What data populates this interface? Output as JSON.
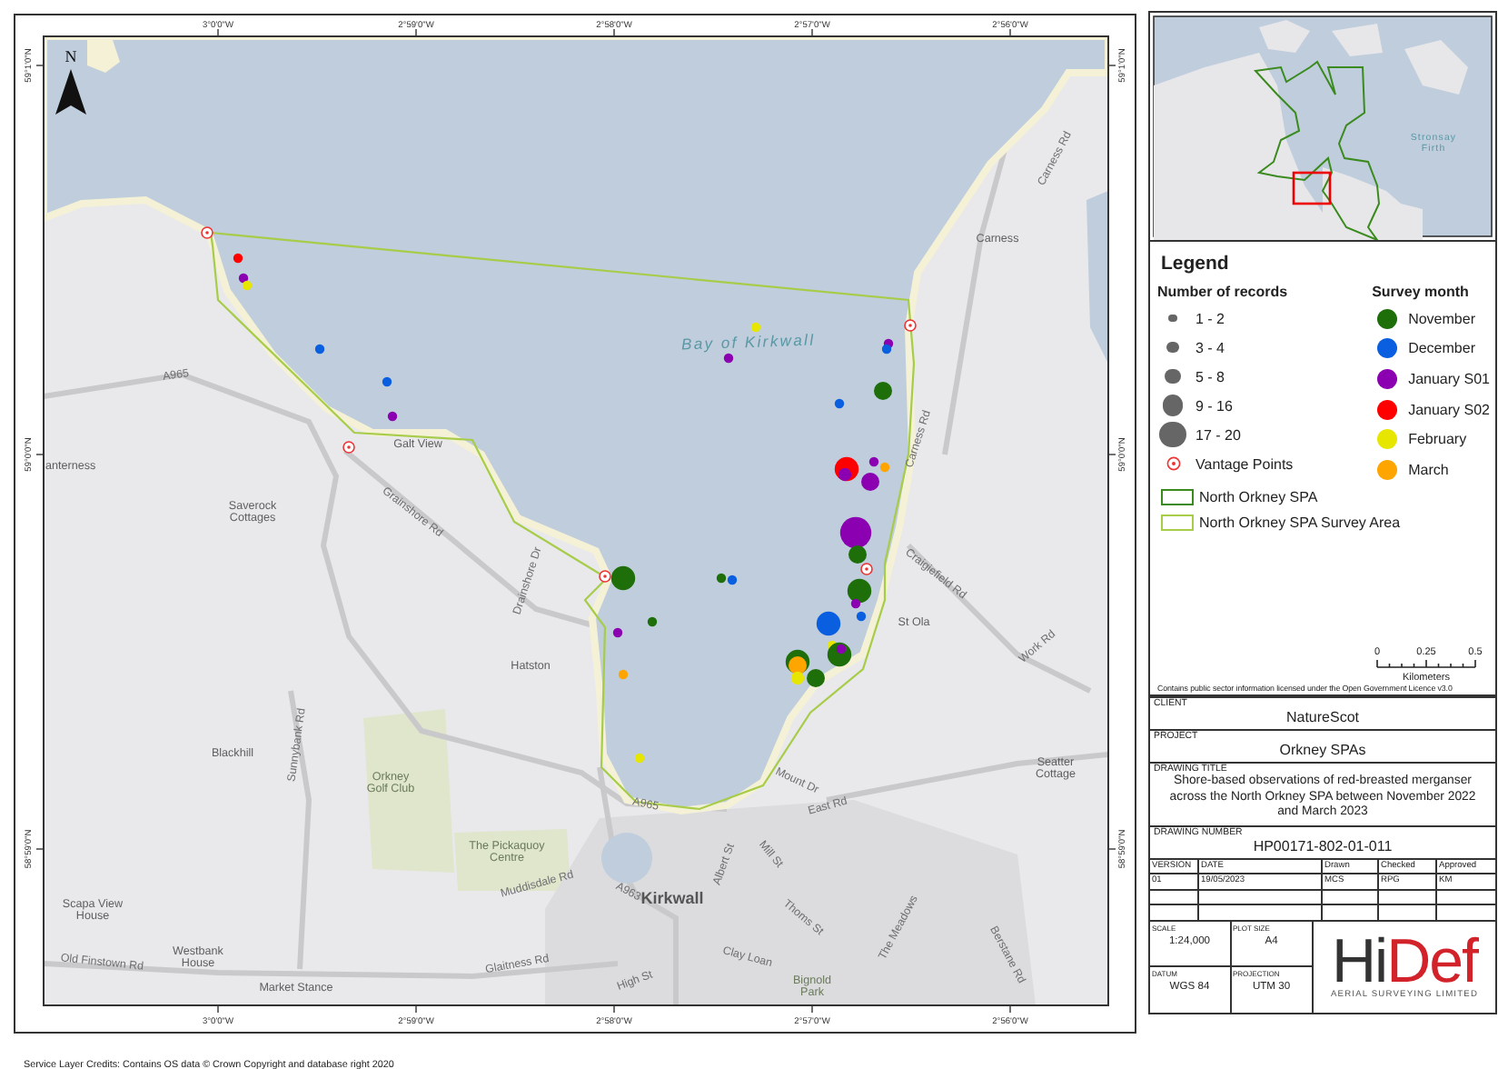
{
  "map": {
    "graticule": {
      "top": [
        "3°0'0\"W",
        "2°59'0\"W",
        "2°58'0\"W",
        "2°57'0\"W",
        "2°56'0\"W"
      ],
      "bottom": [
        "3°0'0\"W",
        "2°59'0\"W",
        "2°58'0\"W",
        "2°57'0\"W",
        "2°56'0\"W"
      ],
      "left": [
        "59°1'0\"N",
        "59°0'0\"N",
        "58°59'0\"N"
      ],
      "right": [
        "59°1'0\"N",
        "59°0'0\"N",
        "58°59'0\"N"
      ]
    },
    "north_label": "N",
    "labels": [
      {
        "kind": "water",
        "lines": [
          "Bay of Kirkwall"
        ]
      },
      {
        "kind": "place",
        "lines": [
          "Carness"
        ]
      },
      {
        "kind": "road",
        "lines": [
          "Carness Rd"
        ]
      },
      {
        "kind": "road",
        "lines": [
          "Carness Rd"
        ]
      },
      {
        "kind": "road",
        "lines": [
          "A965"
        ]
      },
      {
        "kind": "place",
        "lines": [
          "Galt View"
        ]
      },
      {
        "kind": "place",
        "lines": [
          "anterness"
        ]
      },
      {
        "kind": "place",
        "lines": [
          "Saverock",
          "Cottages"
        ]
      },
      {
        "kind": "road",
        "lines": [
          "Grainshore Rd"
        ]
      },
      {
        "kind": "road",
        "lines": [
          "Drainshore Dr"
        ]
      },
      {
        "kind": "place",
        "lines": [
          "Hatston"
        ]
      },
      {
        "kind": "place",
        "lines": [
          "St Ola"
        ]
      },
      {
        "kind": "road",
        "lines": [
          "Craigiefield Rd"
        ]
      },
      {
        "kind": "road",
        "lines": [
          "Work Rd"
        ]
      },
      {
        "kind": "place",
        "lines": [
          "Blackhill"
        ]
      },
      {
        "kind": "road",
        "lines": [
          "Sunnybank Rd"
        ]
      },
      {
        "kind": "park",
        "lines": [
          "Orkney",
          "Golf Club"
        ]
      },
      {
        "kind": "road",
        "lines": [
          "A965"
        ]
      },
      {
        "kind": "road",
        "lines": [
          "Mount Dr"
        ]
      },
      {
        "kind": "road",
        "lines": [
          "East Rd"
        ]
      },
      {
        "kind": "place",
        "lines": [
          "Seatter",
          "Cottage"
        ]
      },
      {
        "kind": "park",
        "lines": [
          "The Pickaquoy",
          "Centre"
        ]
      },
      {
        "kind": "road",
        "lines": [
          "Muddisdale Rd"
        ]
      },
      {
        "kind": "road",
        "lines": [
          "A963"
        ]
      },
      {
        "kind": "town",
        "lines": [
          "Kirkwall"
        ]
      },
      {
        "kind": "road",
        "lines": [
          "Albert St"
        ]
      },
      {
        "kind": "road",
        "lines": [
          "Mill St"
        ]
      },
      {
        "kind": "road",
        "lines": [
          "Thoms St"
        ]
      },
      {
        "kind": "place",
        "lines": [
          "Scapa View",
          "House"
        ]
      },
      {
        "kind": "place",
        "lines": [
          "Westbank",
          "House"
        ]
      },
      {
        "kind": "road",
        "lines": [
          "Old Finstown Rd"
        ]
      },
      {
        "kind": "place",
        "lines": [
          "Market Stance"
        ]
      },
      {
        "kind": "road",
        "lines": [
          "Glaitness Rd"
        ]
      },
      {
        "kind": "road",
        "lines": [
          "High St"
        ]
      },
      {
        "kind": "road",
        "lines": [
          "Clay Loan"
        ]
      },
      {
        "kind": "park",
        "lines": [
          "Bignold",
          "Park"
        ]
      },
      {
        "kind": "road",
        "lines": [
          "The Meadows"
        ]
      },
      {
        "kind": "road",
        "lines": [
          "Berstane Rd"
        ]
      }
    ],
    "observations": [
      {
        "kind": "xs",
        "color": "#ff0000"
      },
      {
        "kind": "xs",
        "color": "#8b00b0"
      },
      {
        "kind": "xs",
        "color": "#e6e600"
      },
      {
        "kind": "xs",
        "color": "#0a5fe0"
      },
      {
        "kind": "xs",
        "color": "#0a5fe0"
      },
      {
        "kind": "xs",
        "color": "#8b00b0"
      },
      {
        "kind": "xs",
        "color": "#e6e600"
      },
      {
        "kind": "xs",
        "color": "#8b00b0"
      },
      {
        "kind": "xs",
        "color": "#8b00b0"
      },
      {
        "kind": "xs",
        "color": "#0a5fe0"
      },
      {
        "kind": "m",
        "color": "#1e6e0a"
      },
      {
        "kind": "xs",
        "color": "#0a5fe0"
      },
      {
        "kind": "l",
        "color": "#ff0000"
      },
      {
        "kind": "s",
        "color": "#8b00b0"
      },
      {
        "kind": "xs",
        "color": "#8b00b0"
      },
      {
        "kind": "xs",
        "color": "#ffa500"
      },
      {
        "kind": "m",
        "color": "#8b00b0"
      },
      {
        "kind": "xl",
        "color": "#8b00b0"
      },
      {
        "kind": "m",
        "color": "#1e6e0a"
      },
      {
        "kind": "l",
        "color": "#1e6e0a"
      },
      {
        "kind": "xs",
        "color": "#1e6e0a"
      },
      {
        "kind": "xs",
        "color": "#0a5fe0"
      },
      {
        "kind": "xs",
        "color": "#1e6e0a"
      },
      {
        "kind": "l",
        "color": "#1e6e0a"
      },
      {
        "kind": "xs",
        "color": "#8b00b0"
      },
      {
        "kind": "xs",
        "color": "#0a5fe0"
      },
      {
        "kind": "xs",
        "color": "#8b00b0"
      },
      {
        "kind": "l",
        "color": "#0a5fe0"
      },
      {
        "kind": "xs",
        "color": "#e6e600"
      },
      {
        "kind": "l",
        "color": "#1e6e0a"
      },
      {
        "kind": "xs",
        "color": "#8b00b0"
      },
      {
        "kind": "l",
        "color": "#1e6e0a"
      },
      {
        "kind": "m",
        "color": "#ffa500"
      },
      {
        "kind": "s",
        "color": "#e6e600"
      },
      {
        "kind": "m",
        "color": "#1e6e0a"
      },
      {
        "kind": "xs",
        "color": "#ffa500"
      },
      {
        "kind": "xs",
        "color": "#e6e600"
      }
    ]
  },
  "credits": "Service Layer Credits: Contains OS data © Crown Copyright and database right 2020",
  "inset": {
    "labels": [
      {
        "lines": [
          "Stronsay",
          "Firth"
        ]
      }
    ]
  },
  "legend": {
    "title": "Legend",
    "records_heading": "Number of records",
    "record_classes": [
      {
        "kind": "xs",
        "label": "1 - 2"
      },
      {
        "kind": "s",
        "label": "3 - 4"
      },
      {
        "kind": "m",
        "label": "5 - 8"
      },
      {
        "kind": "l",
        "label": "9 - 16"
      },
      {
        "kind": "xl",
        "label": "17 - 20"
      }
    ],
    "months_heading": "Survey month",
    "months": [
      {
        "label": "November",
        "color": "#1e6e0a"
      },
      {
        "label": "December",
        "color": "#0a5fe0"
      },
      {
        "label": "January S01",
        "color": "#8b00b0"
      },
      {
        "label": "January S02",
        "color": "#ff0000"
      },
      {
        "label": "February",
        "color": "#e6e600"
      },
      {
        "label": "March",
        "color": "#ffa500"
      }
    ],
    "vantage_label": "Vantage Points",
    "boundaries": [
      {
        "label": "North Orkney SPA",
        "color": "#3a8a1e"
      },
      {
        "label": "North Orkney SPA Survey Area",
        "color": "#a6cc48"
      }
    ],
    "scale_bar": {
      "ticks": [
        "0",
        "0.25",
        "0.5"
      ],
      "unit": "Kilometers"
    },
    "licence": "Contains public sector information licensed under the Open Government Licence v3.0"
  },
  "title_block": {
    "client_label": "CLIENT",
    "client": "NatureScot",
    "project_label": "PROJECT",
    "project": "Orkney SPAs",
    "drawing_title_label": "DRAWING TITLE",
    "drawing_title": "Shore-based observations of red-breasted merganser across the North Orkney SPA between November 2022 and March 2023",
    "drawing_number_label": "DRAWING NUMBER",
    "drawing_number": "HP00171-802-01-011",
    "revision_columns": [
      "VERSION",
      "DATE",
      "Drawn",
      "Checked",
      "Approved"
    ],
    "revision_rows": [
      [
        "01",
        "19/05/2023",
        "MCS",
        "RPG",
        "KM"
      ]
    ],
    "details": [
      {
        "label": "SCALE",
        "value": "1:24,000"
      },
      {
        "label": "PLOT SIZE",
        "value": "A4"
      },
      {
        "label": "DATUM",
        "value": "WGS 84"
      },
      {
        "label": "PROJECTION",
        "value": "UTM 30"
      }
    ],
    "logo": {
      "dark": "Hi",
      "accent": "Def",
      "tagline": "AERIAL SURVEYING LIMITED"
    }
  }
}
